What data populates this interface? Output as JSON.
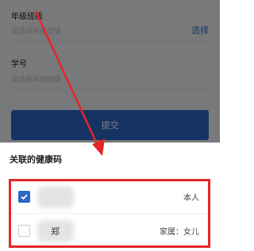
{
  "form": {
    "grade_class_label": "年级班级",
    "grade_class_placeholder": "请选择年级班级",
    "select_link": "选择",
    "student_id_label": "学号",
    "student_id_placeholder": "请选择年级班级",
    "submit_label": "提交"
  },
  "sheet": {
    "title": "关联的健康码",
    "rows": [
      {
        "name": "",
        "relation": "本人",
        "checked": true
      },
      {
        "name": "郑",
        "relation": "家属：女儿",
        "checked": false
      }
    ]
  },
  "colors": {
    "accent": "#2b68c7",
    "highlight": "#e32727"
  }
}
